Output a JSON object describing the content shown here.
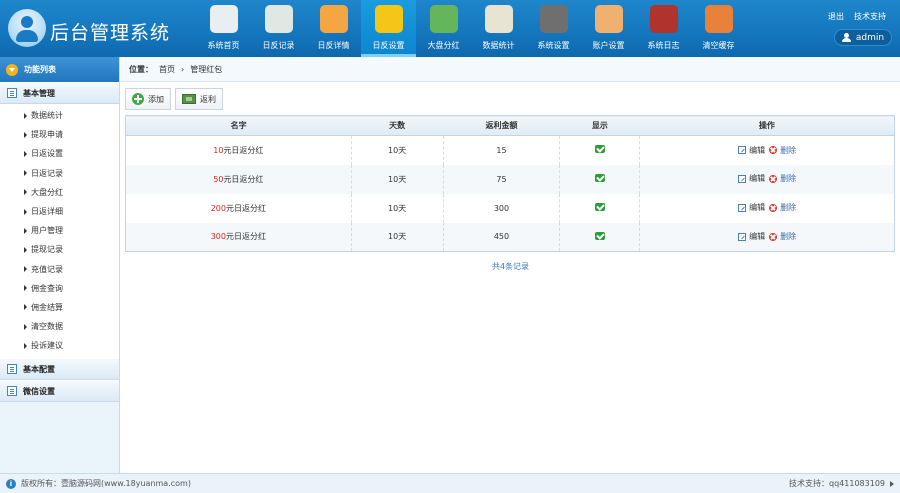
{
  "header": {
    "title": "后台管理系统",
    "nav": [
      {
        "label": "系统首页",
        "icon": "home-icon",
        "color": "#e9eef2"
      },
      {
        "label": "日反记录",
        "icon": "clock-icon",
        "color": "#dfe8e2"
      },
      {
        "label": "日反详情",
        "icon": "document-icon",
        "color": "#f3a641"
      },
      {
        "label": "日反设置",
        "icon": "gear-icon",
        "color": "#f5c518",
        "active": true
      },
      {
        "label": "大盘分红",
        "icon": "money-icon",
        "color": "#64b55b"
      },
      {
        "label": "数据统计",
        "icon": "chart-icon",
        "color": "#e8e4d4"
      },
      {
        "label": "系统设置",
        "icon": "settings-icon",
        "color": "#6f6f6f"
      },
      {
        "label": "账户设置",
        "icon": "user-icon",
        "color": "#f0b070"
      },
      {
        "label": "系统日志",
        "icon": "book-icon",
        "color": "#b0332c"
      },
      {
        "label": "清空缓存",
        "icon": "tools-icon",
        "color": "#e8823a"
      }
    ],
    "links": {
      "logout": "退出",
      "support": "技术支持"
    },
    "user": "admin"
  },
  "sidebar": {
    "title": "功能列表",
    "groups": [
      {
        "label": "基本管理"
      },
      {
        "label": "基本配置"
      },
      {
        "label": "微信设置"
      }
    ],
    "items": [
      "数据统计",
      "提现申请",
      "日返设置",
      "日返记录",
      "大盘分红",
      "日返详细",
      "用户管理",
      "提现记录",
      "充值记录",
      "佣金查询",
      "佣金结算",
      "清空数据",
      "投诉建议"
    ]
  },
  "breadcrumb": {
    "label": "位置：",
    "home": "首页",
    "sep": "›",
    "current": "管理红包"
  },
  "toolbar": {
    "add": "添加",
    "rebate": "返利"
  },
  "table": {
    "headers": [
      "名字",
      "天数",
      "返利金额",
      "显示",
      "操作"
    ],
    "rows": [
      {
        "amount": "10",
        "name_suffix": "元日返分红",
        "days": "10天",
        "rebate": "15"
      },
      {
        "amount": "50",
        "name_suffix": "元日返分红",
        "days": "10天",
        "rebate": "75"
      },
      {
        "amount": "200",
        "name_suffix": "元日返分红",
        "days": "10天",
        "rebate": "300"
      },
      {
        "amount": "300",
        "name_suffix": "元日返分红",
        "days": "10天",
        "rebate": "450"
      }
    ],
    "edit_label": "编辑",
    "delete_label": "删除"
  },
  "total": "共4条记录",
  "footer": {
    "copyright": "版权所有：壹脑源码网(www.18yuanma.com)",
    "support": "技术支持：qq411083109"
  }
}
